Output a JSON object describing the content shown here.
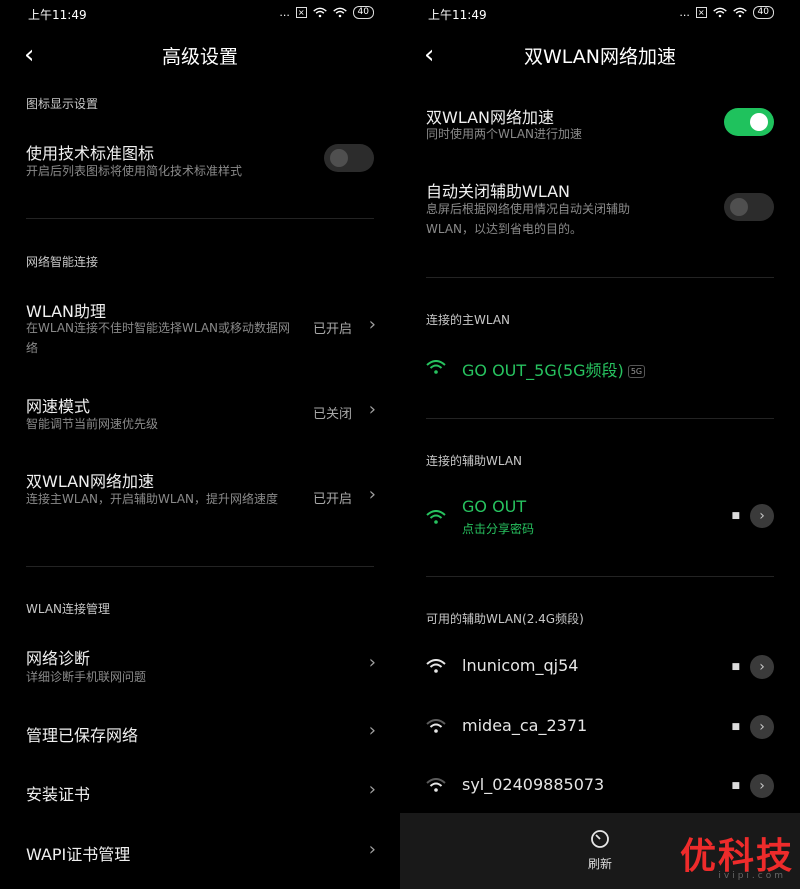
{
  "status_bar": {
    "time": "上午11:49",
    "dots": "...",
    "sim": "×",
    "battery": "40"
  },
  "left": {
    "header": {
      "title": "高级设置"
    },
    "sections": [
      {
        "label": "图标显示设置"
      },
      {
        "label": "网络智能连接"
      },
      {
        "label": "WLAN连接管理"
      }
    ],
    "tech_icons": {
      "title": "使用技术标准图标",
      "subtitle": "开启后列表图标将使用简化技术标准样式",
      "enabled": false
    },
    "wlan_assist": {
      "title": "WLAN助理",
      "subtitle": "在WLAN连接不佳时智能选择WLAN或移动数据网络",
      "status": "已开启"
    },
    "speed_mode": {
      "title": "网速模式",
      "subtitle": "智能调节当前网速优先级",
      "status": "已关闭"
    },
    "dual_wlan": {
      "title": "双WLAN网络加速",
      "subtitle": "连接主WLAN，开启辅助WLAN，提升网络速度",
      "status": "已开启"
    },
    "diagnosis": {
      "title": "网络诊断",
      "subtitle": "详细诊断手机联网问题"
    },
    "saved_networks": {
      "title": "管理已保存网络"
    },
    "install_cert": {
      "title": "安装证书"
    },
    "wapi_cert": {
      "title": "WAPI证书管理"
    }
  },
  "right": {
    "header": {
      "title": "双WLAN网络加速"
    },
    "dual_toggle": {
      "title": "双WLAN网络加速",
      "subtitle": "同时使用两个WLAN进行加速",
      "enabled": true
    },
    "auto_close": {
      "title": "自动关闭辅助WLAN",
      "subtitle": "息屏后根据网络使用情况自动关闭辅助WLAN，以达到省电的目的。",
      "enabled": false
    },
    "primary": {
      "label": "连接的主WLAN",
      "ssid": "GO OUT_5G(5G频段)",
      "band_tag": "5G"
    },
    "secondary": {
      "label": "连接的辅助WLAN",
      "ssid": "GO OUT",
      "action": "点击分享密码"
    },
    "available": {
      "label": "可用的辅助WLAN(2.4G频段)",
      "networks": [
        {
          "ssid": "lnunicom_qj54"
        },
        {
          "ssid": "midea_ca_2371"
        },
        {
          "ssid": "syl_02409885073"
        }
      ]
    },
    "bottom": {
      "refresh_label": "刷新"
    },
    "watermark": {
      "text": "优科技",
      "sub": "ivipi.com"
    }
  },
  "colors": {
    "accent_green": "#27c25f",
    "toggle_on": "#1fc25d",
    "background": "#000000"
  }
}
